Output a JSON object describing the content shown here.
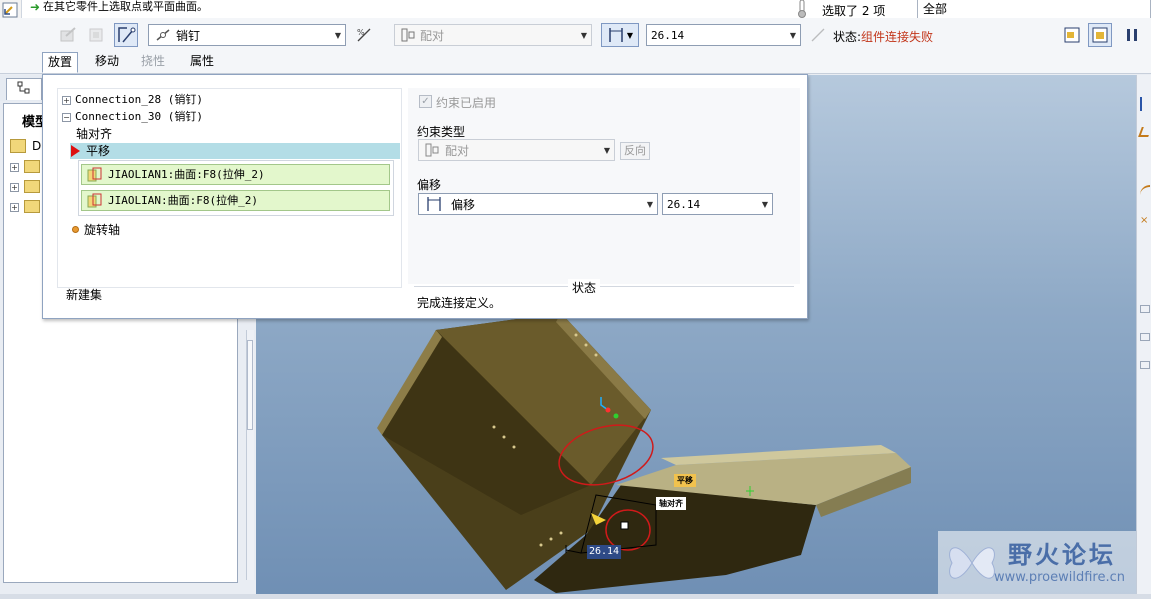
{
  "message": {
    "text": "在其它零件上选取点或平面曲面。"
  },
  "selection": {
    "text": "选取了 2 项",
    "filter": "全部"
  },
  "dashboard": {
    "connection_type": "销钉",
    "constraint_dropdown": "配对",
    "offset_value": "26.14",
    "status_label": "状态:",
    "status_value": "组件连接失败",
    "tabs": [
      {
        "label": "放置",
        "state": "active"
      },
      {
        "label": "移动",
        "state": "normal"
      },
      {
        "label": "挠性",
        "state": "disabled"
      },
      {
        "label": "属性",
        "state": "normal"
      }
    ]
  },
  "tree": {
    "title": "模型",
    "root_label": "D"
  },
  "panel": {
    "connections": [
      {
        "label": "Connection_28 (销钉)",
        "expanded": false
      },
      {
        "label": "Connection_30 (销钉)",
        "expanded": true
      }
    ],
    "constraints": [
      {
        "label": "轴对齐"
      },
      {
        "label": "平移"
      },
      {
        "label": "旋转轴"
      }
    ],
    "references": [
      {
        "label": "JIAOLIAN1:曲面:F8(拉伸_2)"
      },
      {
        "label": "JIAOLIAN:曲面:F8(拉伸_2)"
      }
    ],
    "new_set": "新建集",
    "enabled_checkbox": "约束已启用",
    "constraint_type_label": "约束类型",
    "constraint_type_value": "配对",
    "flip_button": "反向",
    "offset_label": "偏移",
    "offset_type": "偏移",
    "offset_value": "26.14",
    "status_heading": "状态",
    "status_text": "完成连接定义。"
  },
  "viewport": {
    "dimension_tag": "26.14",
    "label_translate": "平移",
    "label_axis_align": "轴对齐"
  },
  "watermark": {
    "title": "野火论坛",
    "url": "www.proewildfire.cn"
  },
  "colors": {
    "status_error": "#c2361b",
    "selected_row": "#b3dde6",
    "reference_bg": "#e3f7cc"
  }
}
